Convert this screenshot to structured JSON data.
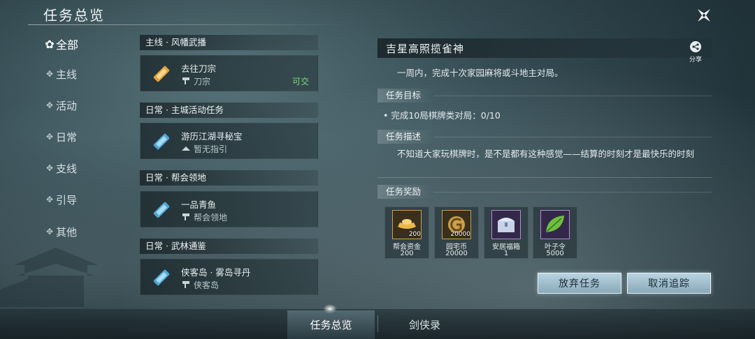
{
  "header": {
    "title": "任务总览"
  },
  "nav": {
    "items": [
      {
        "label": "全部",
        "active": true
      },
      {
        "label": "主线"
      },
      {
        "label": "活动"
      },
      {
        "label": "日常"
      },
      {
        "label": "支线"
      },
      {
        "label": "引导"
      },
      {
        "label": "其他"
      }
    ]
  },
  "quests": [
    {
      "category": "主线 · 风幡武播",
      "name": "去往刀宗",
      "location": "刀宗",
      "status": "可交",
      "icon": "quest-scroll-gold-icon",
      "location_icon": "waypoint-icon"
    },
    {
      "category": "日常 · 主城活动任务",
      "name": "游历江湖寻秘宝",
      "location": "暂无指引",
      "status": "",
      "icon": "quest-scroll-blue-icon",
      "location_icon": "no-guide-icon"
    },
    {
      "category": "日常 · 帮会领地",
      "name": "一品青鱼",
      "location": "帮会领地",
      "status": "",
      "icon": "quest-scroll-blue-icon",
      "location_icon": "waypoint-icon"
    },
    {
      "category": "日常 · 武林通鉴",
      "name": "侠客岛 · 雾岛寻丹",
      "location": "侠客岛",
      "status": "",
      "icon": "quest-scroll-blue-icon",
      "location_icon": "waypoint-icon"
    }
  ],
  "detail": {
    "title": "吉星高照揽雀神",
    "share_label": "分享",
    "description": "一周内，完成十次家园麻将或斗地主对局。",
    "goal_heading": "任务目标",
    "goal": "完成10局棋牌类对局：0/10",
    "story_heading": "任务描述",
    "story": "不知道大家玩棋牌时，是不是都有这种感觉——结算的时刻才是最快乐的时刻",
    "reward_heading": "任务奖励",
    "rewards": [
      {
        "name": "帮会资金",
        "count": "200",
        "badge": "200",
        "icon": "gold-ingot-icon",
        "frame_color": "#c9a050"
      },
      {
        "name": "园宅币",
        "count": "20000",
        "badge": "20000",
        "icon": "home-coin-icon",
        "frame_color": "#c9a050"
      },
      {
        "name": "安居福箱",
        "count": "1",
        "badge": "",
        "icon": "treasure-chest-icon",
        "frame_color": "#b58ad6"
      },
      {
        "name": "叶子令",
        "count": "5000",
        "badge": "",
        "icon": "leaf-token-icon",
        "frame_color": "#b58ad6"
      }
    ]
  },
  "buttons": {
    "abandon": "放弃任务",
    "untrack": "取消追踪"
  },
  "tabs": [
    {
      "label": "任务总览",
      "active": true
    },
    {
      "label": "剑侠录"
    }
  ]
}
